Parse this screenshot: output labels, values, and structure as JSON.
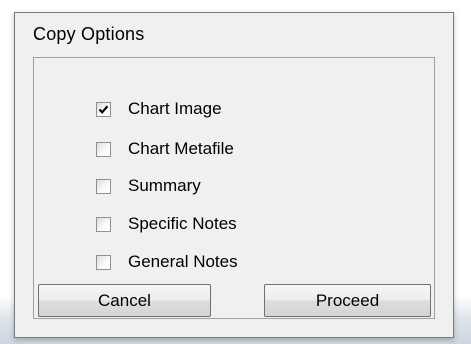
{
  "dialog": {
    "title": "Copy Options"
  },
  "options": [
    {
      "label": "Chart Image",
      "checked": true
    },
    {
      "label": "Chart Metafile",
      "checked": false
    },
    {
      "label": "Summary",
      "checked": false
    },
    {
      "label": "Specific Notes",
      "checked": false
    },
    {
      "label": "General Notes",
      "checked": false
    }
  ],
  "buttons": {
    "cancel_label": "Cancel",
    "proceed_label": "Proceed"
  }
}
